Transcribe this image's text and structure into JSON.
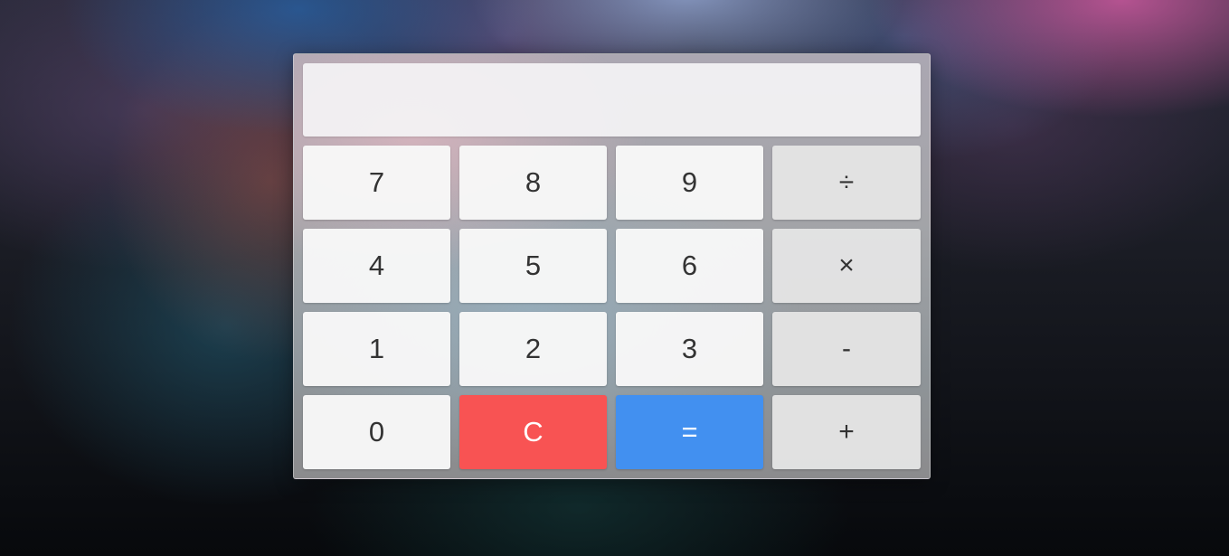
{
  "calculator": {
    "display": {
      "value": ""
    },
    "keys": [
      {
        "label": "7",
        "kind": "digit"
      },
      {
        "label": "8",
        "kind": "digit"
      },
      {
        "label": "9",
        "kind": "digit"
      },
      {
        "label": "÷",
        "kind": "operator"
      },
      {
        "label": "4",
        "kind": "digit"
      },
      {
        "label": "5",
        "kind": "digit"
      },
      {
        "label": "6",
        "kind": "digit"
      },
      {
        "label": "×",
        "kind": "operator"
      },
      {
        "label": "1",
        "kind": "digit"
      },
      {
        "label": "2",
        "kind": "digit"
      },
      {
        "label": "3",
        "kind": "digit"
      },
      {
        "label": "-",
        "kind": "operator"
      },
      {
        "label": "0",
        "kind": "digit"
      },
      {
        "label": "C",
        "kind": "clear"
      },
      {
        "label": "=",
        "kind": "equals"
      },
      {
        "label": "+",
        "kind": "operator"
      }
    ]
  },
  "colors": {
    "clear_button": "#f85353",
    "equals_button": "#4290f0",
    "digit_button": "#f8f8f8",
    "operator_button": "#e4e4e4",
    "key_text": "#333333"
  }
}
